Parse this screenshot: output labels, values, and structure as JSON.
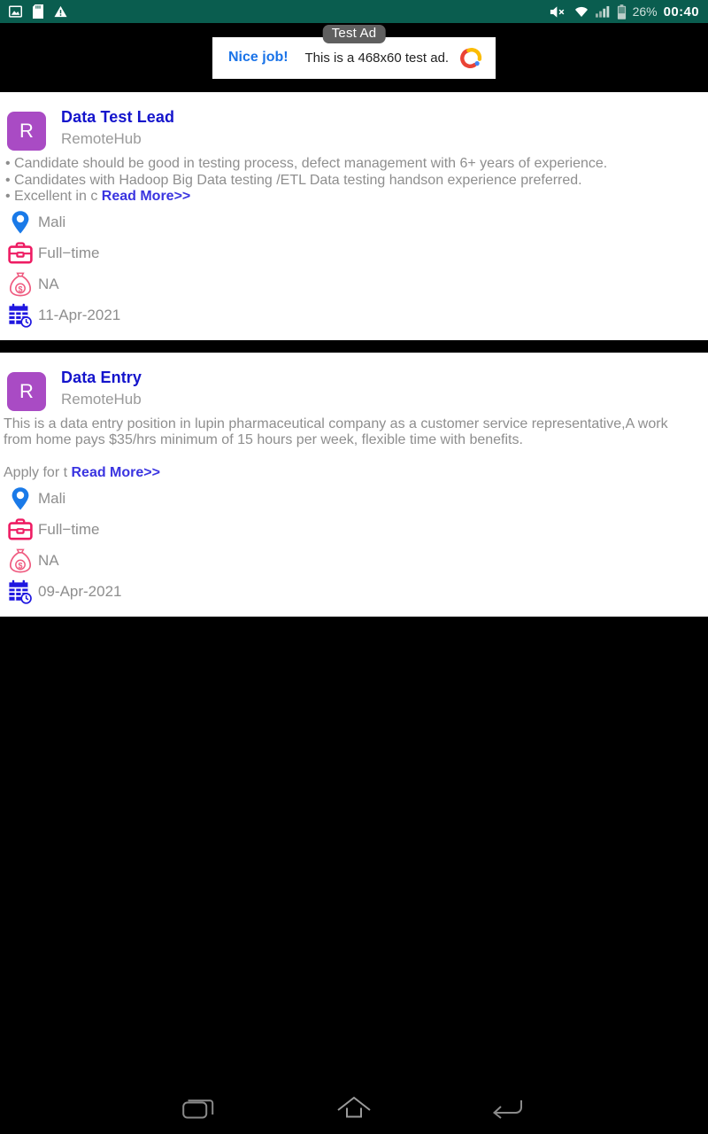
{
  "statusbar": {
    "icons_left": [
      "screenshot-icon",
      "sd-card-icon",
      "warning-icon"
    ],
    "icons_right": [
      "volume-mute-icon",
      "wifi-icon",
      "signal-icon",
      "battery-icon"
    ],
    "battery_percent": "26%",
    "clock": "00:40",
    "background_color": "#0a5d4f"
  },
  "ad": {
    "cta_label": "Nice job!",
    "body_text": "This is a 468x60 test ad.",
    "badge_label": "Test Ad",
    "logo_name": "admob-logo",
    "cta_color": "#1a73e8"
  },
  "jobs": [
    {
      "avatar_letter": "R",
      "avatar_color": "#a94bc4",
      "title": "Data Test Lead",
      "company": "RemoteHub",
      "description": "• Candidate should be good in testing process, defect management with 6+ years of experience.\n• Candidates with Hadoop Big Data testing /ETL Data testing handson experience preferred.\n• Excellent in c ",
      "read_more_label": "Read More>>",
      "meta": [
        {
          "icon": "location-pin-icon",
          "label": "Mali"
        },
        {
          "icon": "briefcase-icon",
          "label": "Full−time"
        },
        {
          "icon": "money-bag-icon",
          "label": "NA"
        },
        {
          "icon": "calendar-clock-icon",
          "label": "11-Apr-2021"
        }
      ]
    },
    {
      "avatar_letter": "R",
      "avatar_color": "#a94bc4",
      "title": "Data Entry",
      "company": "RemoteHub",
      "description": "This is a data entry position in lupin pharmaceutical company as a customer service representative,A work from home pays $35/hrs minimum of 15 hours per week, flexible time with benefits.\n\nApply for t ",
      "read_more_label": "Read More>>",
      "meta": [
        {
          "icon": "location-pin-icon",
          "label": "Mali"
        },
        {
          "icon": "briefcase-icon",
          "label": "Full−time"
        },
        {
          "icon": "money-bag-icon",
          "label": "NA"
        },
        {
          "icon": "calendar-clock-icon",
          "label": "09-Apr-2021"
        }
      ]
    }
  ],
  "navbar": {
    "buttons": [
      {
        "name": "recents-button",
        "icon": "recents-icon"
      },
      {
        "name": "home-button",
        "icon": "home-icon"
      },
      {
        "name": "back-button",
        "icon": "back-icon"
      }
    ]
  }
}
